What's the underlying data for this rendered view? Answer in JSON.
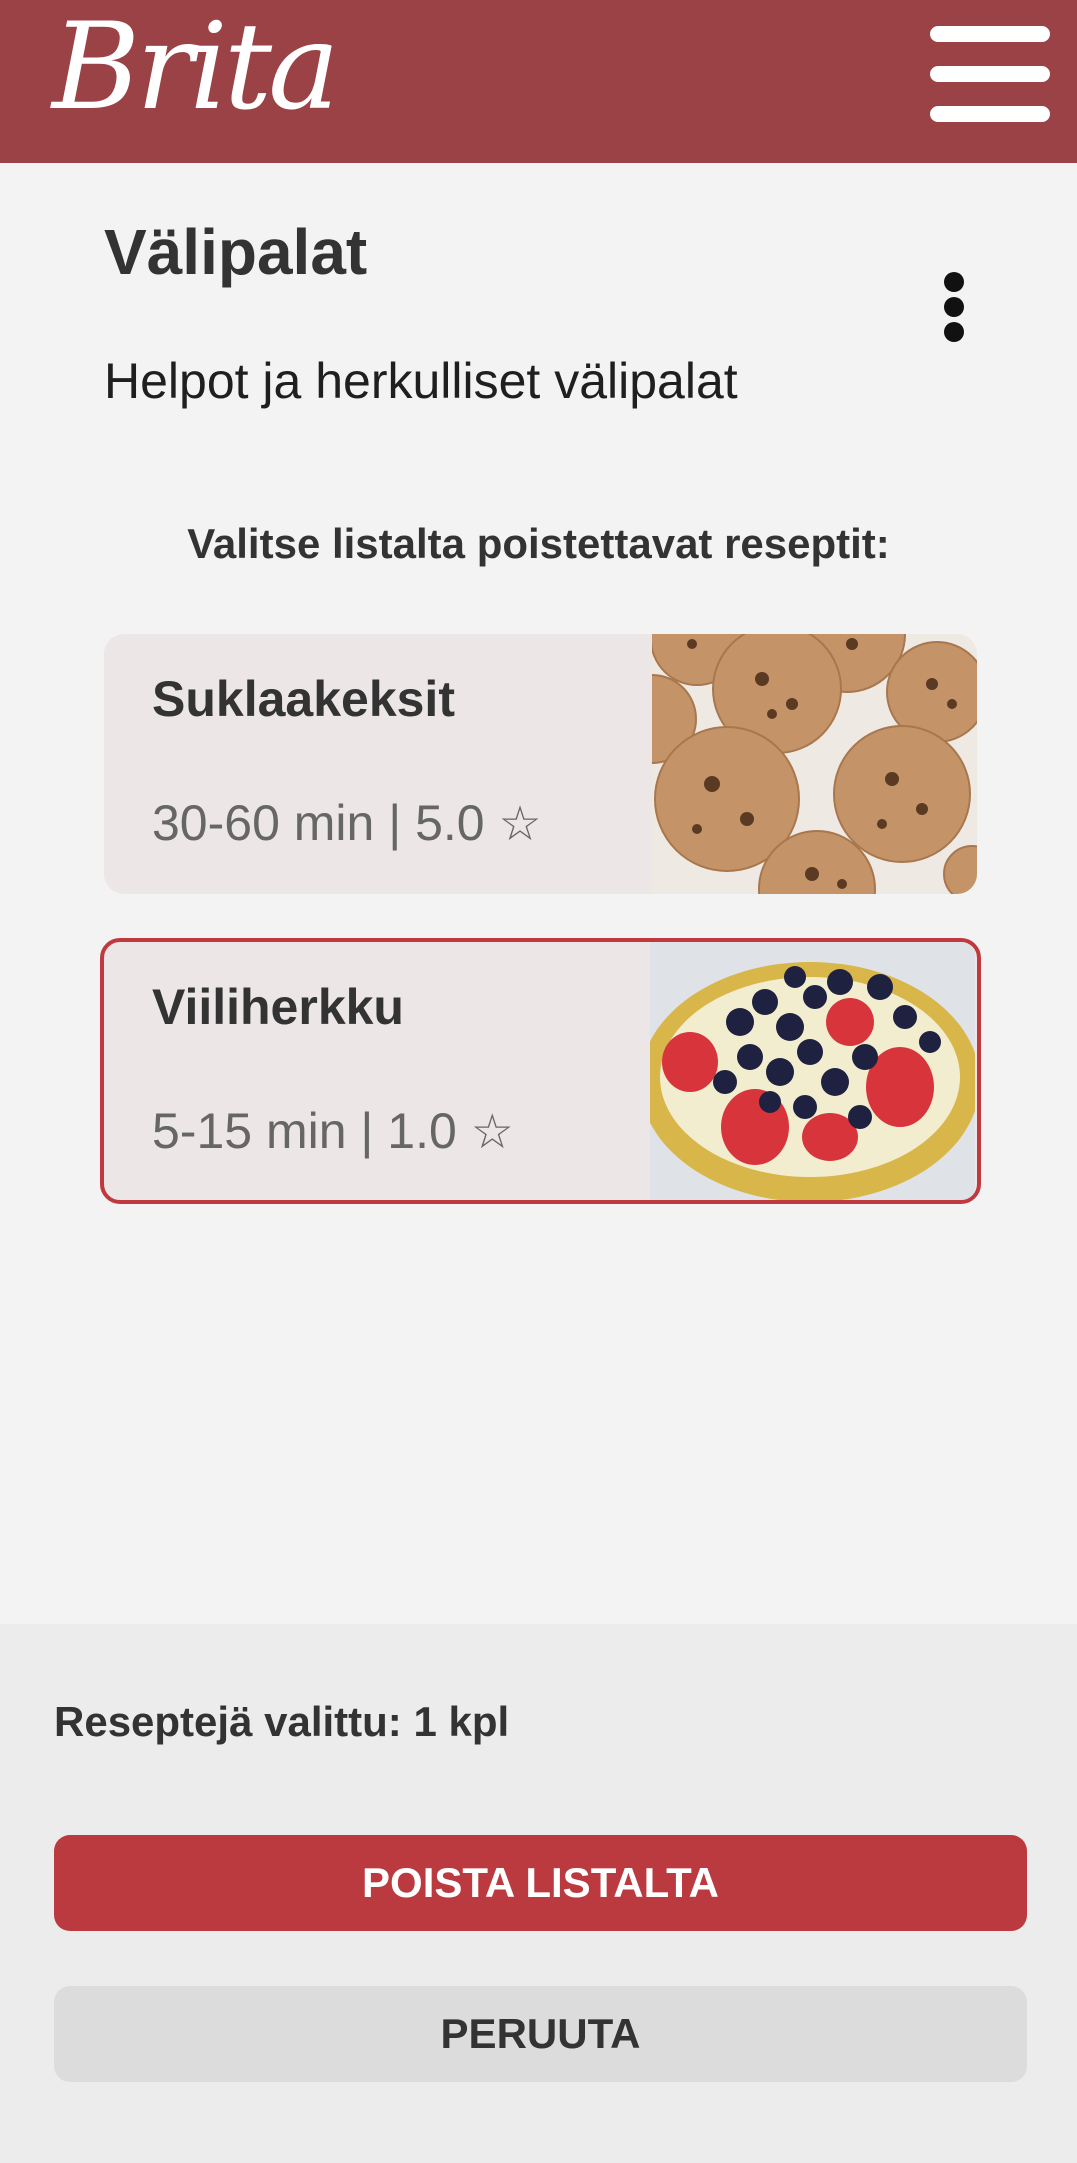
{
  "header": {
    "logo_text": "Brita",
    "menu_icon": "hamburger-menu-icon",
    "brand_color": "#9a4246"
  },
  "page": {
    "title": "Välipalat",
    "subtitle": "Helpot ja herkulliset välipalat",
    "more_icon": "more-vertical-icon",
    "instruction": "Valitse listalta poistettavat reseptit:"
  },
  "recipes": [
    {
      "name": "Suklaakeksit",
      "meta": "30-60 min | 5.0",
      "star": "☆",
      "image": "chocolate-cookies-photo",
      "selected": false
    },
    {
      "name": "Viiliherkku",
      "meta": "5-15 min | 1.0",
      "star": "☆",
      "image": "berry-yogurt-bowl-photo",
      "selected": true
    }
  ],
  "footer": {
    "selected_count": "Reseptejä valittu: 1 kpl",
    "delete_label": "POISTA LISTALTA",
    "cancel_label": "PERUUTA",
    "accent_color": "#bb3a3f"
  }
}
